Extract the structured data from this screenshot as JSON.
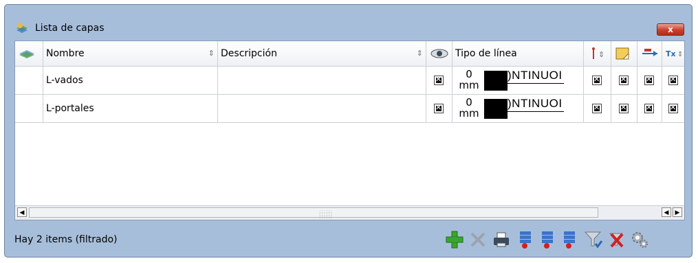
{
  "window": {
    "title": "Lista de capas",
    "close_label": "x"
  },
  "table": {
    "columns": {
      "nombre": "Nombre",
      "descripcion": "Descripción",
      "tipo_linea": "Tipo de línea"
    },
    "rows": [
      {
        "nombre": "L-vados",
        "descripcion": "",
        "width_value": "0",
        "width_unit": "mm",
        "linetype": ")NTINUOI"
      },
      {
        "nombre": "L-portales",
        "descripcion": "",
        "width_value": "0",
        "width_unit": "mm",
        "linetype": ")NTINUOI"
      }
    ]
  },
  "status": {
    "text": "Hay 2 items (filtrado)"
  },
  "colors": {
    "window_bg": "#a7bedb",
    "add_green": "#3aa52c",
    "delete_red": "#d22020"
  },
  "icons": [
    "layers-icon",
    "eye-icon",
    "elevation-icon",
    "label-icon",
    "dimension-icon",
    "text-icon",
    "add-icon",
    "remove-icon",
    "print-icon",
    "insert-above-icon",
    "insert-below-icon",
    "insert-end-icon",
    "filter-icon",
    "clear-filter-icon",
    "settings-icon"
  ]
}
